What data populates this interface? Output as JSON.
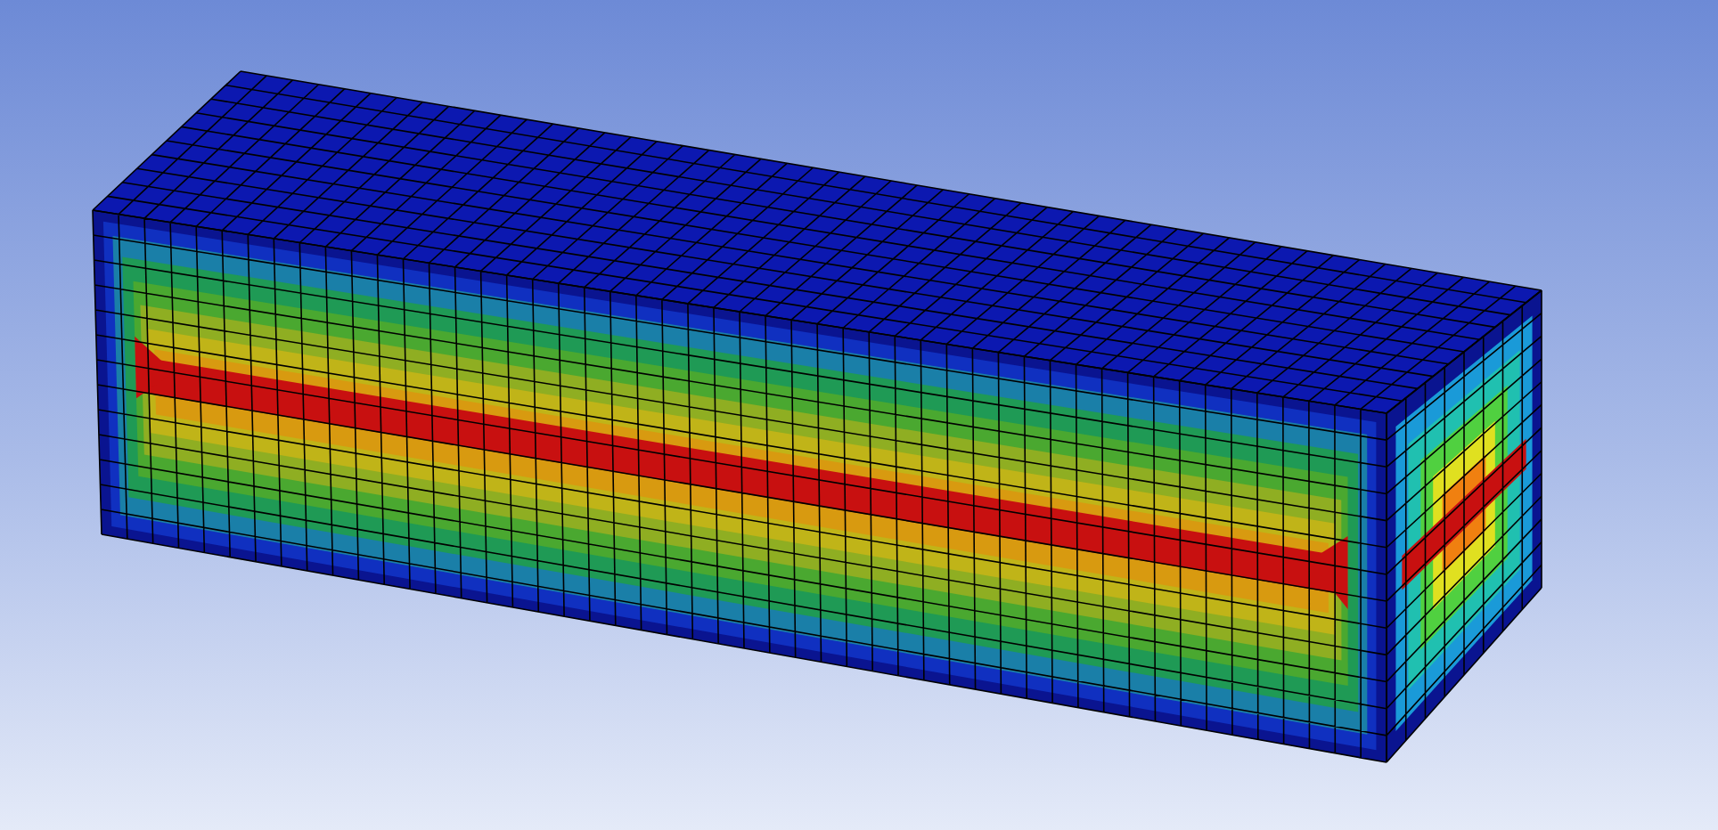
{
  "viewport": {
    "kind": "contour-plot"
  }
}
